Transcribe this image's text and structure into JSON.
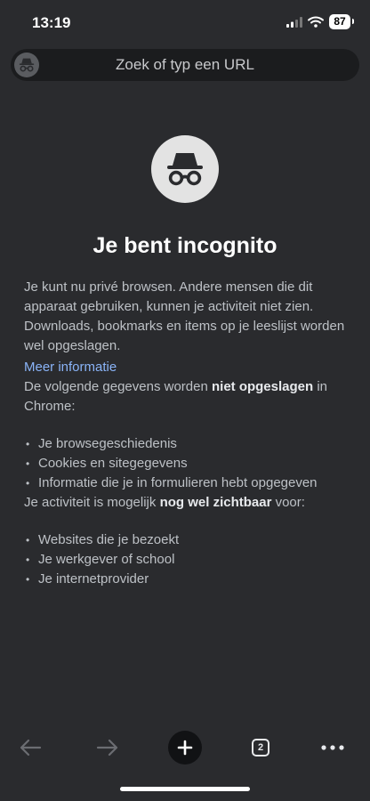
{
  "status": {
    "time": "13:19",
    "battery": "87"
  },
  "url_bar": {
    "placeholder": "Zoek of typ een URL"
  },
  "page": {
    "title": "Je bent incognito",
    "intro": "Je kunt nu privé browsen. Andere mensen die dit apparaat gebruiken, kunnen je activiteit niet zien. Downloads, bookmarks en items op je leeslijst worden wel opgeslagen.",
    "more_info_link": "Meer informatie",
    "not_saved": {
      "lead": "De volgende gegevens worden ",
      "bold": "niet opgeslagen",
      "tail": " in Chrome:",
      "items": [
        "Je browsegeschiedenis",
        "Cookies en sitegegevens",
        "Informatie die je in formulieren hebt opgegeven"
      ]
    },
    "visible": {
      "lead": "Je activiteit is mogelijk ",
      "bold": "nog wel zichtbaar",
      "tail": " voor:",
      "items": [
        "Websites die je bezoekt",
        "Je werkgever of school",
        "Je internetprovider"
      ]
    }
  },
  "toolbar": {
    "tab_count": "2"
  },
  "icons": {
    "incognito": "incognito-icon",
    "back": "arrow-left-icon",
    "forward": "arrow-right-icon",
    "new_tab": "plus-icon",
    "tabs": "tab-switcher-icon",
    "menu": "more-horizontal-icon"
  },
  "colors": {
    "background": "#2a2b2e",
    "link": "#8ab4f8",
    "url_bar": "#1b1c1e"
  }
}
